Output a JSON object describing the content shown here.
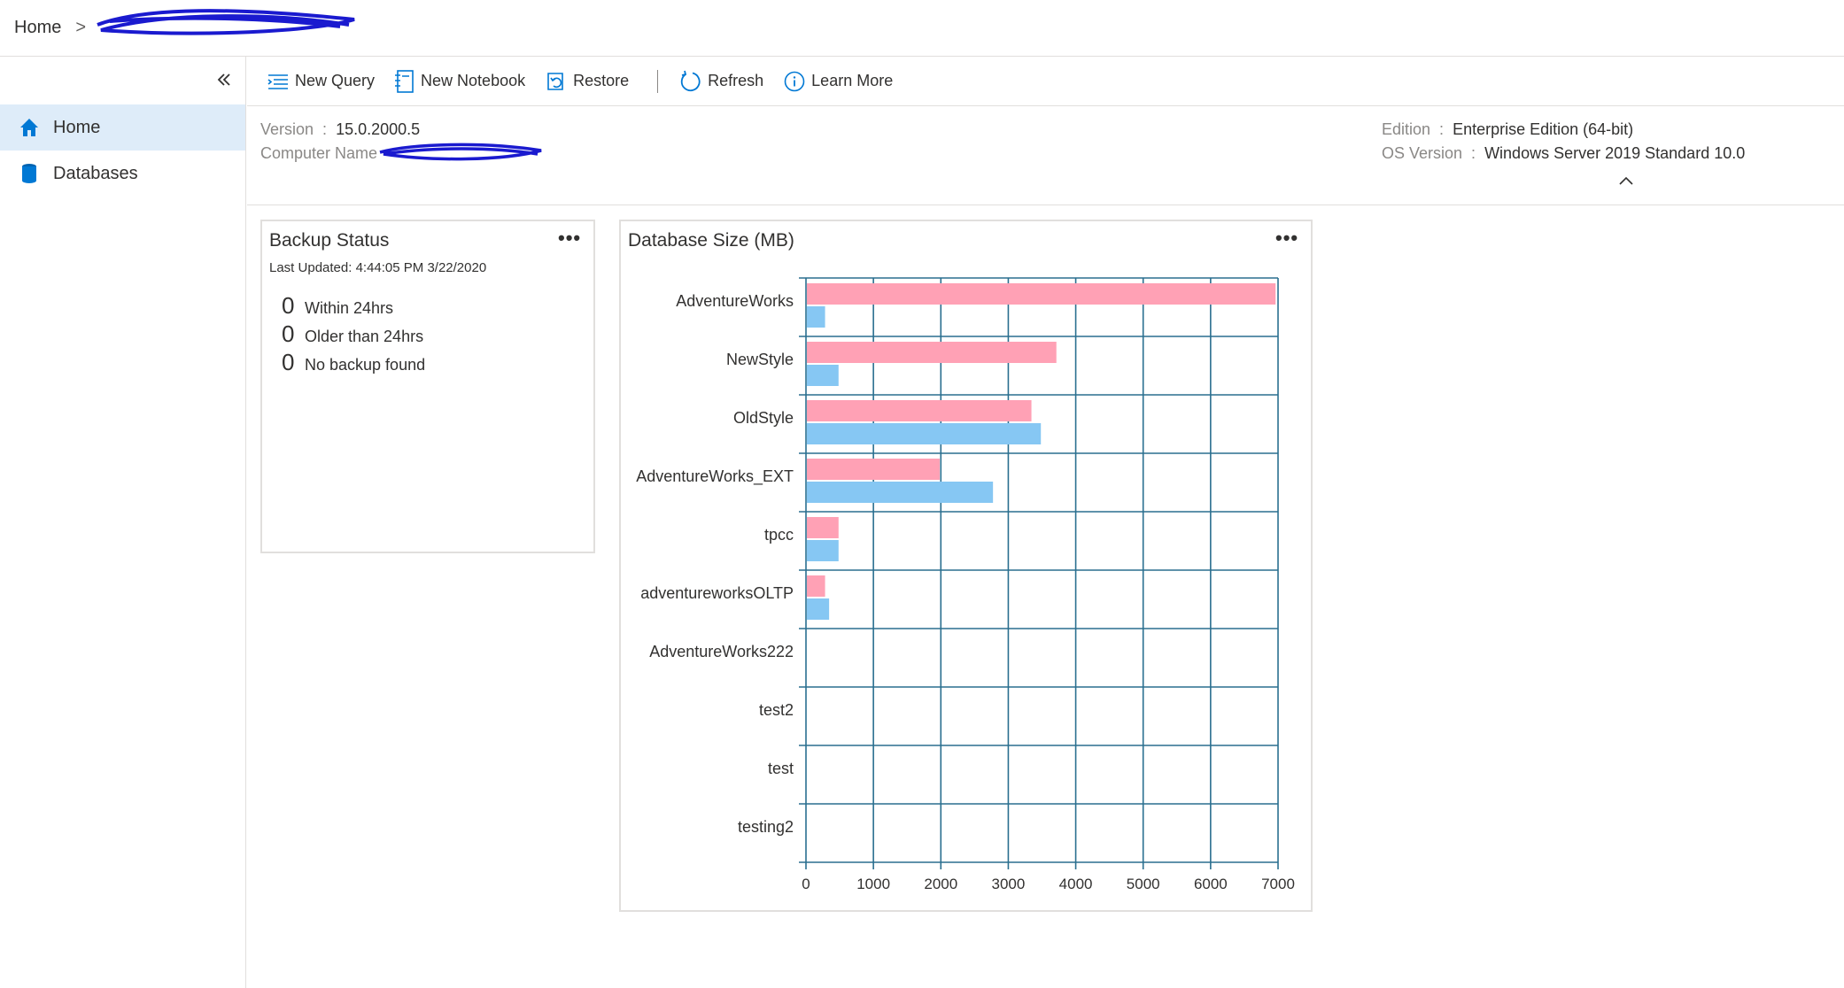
{
  "breadcrumb": {
    "home": "Home",
    "separator": ">"
  },
  "sidebar": {
    "items": [
      {
        "label": "Home",
        "icon": "home-icon",
        "active": true
      },
      {
        "label": "Databases",
        "icon": "database-icon",
        "active": false
      }
    ]
  },
  "toolbar": {
    "new_query": "New Query",
    "new_notebook": "New Notebook",
    "restore": "Restore",
    "refresh": "Refresh",
    "learn_more": "Learn More"
  },
  "properties": {
    "version_label": "Version",
    "version_value": "15.0.2000.5",
    "computer_name_label": "Computer Name",
    "edition_label": "Edition",
    "edition_value": "Enterprise Edition (64-bit)",
    "os_version_label": "OS Version",
    "os_version_value": "Windows Server 2019 Standard 10.0",
    "colon": ":"
  },
  "backup_status": {
    "title": "Backup Status",
    "last_updated": "Last Updated: 4:44:05 PM 3/22/2020",
    "rows": [
      {
        "count": "0",
        "label": "Within 24hrs"
      },
      {
        "count": "0",
        "label": "Older than 24hrs"
      },
      {
        "count": "0",
        "label": "No backup found"
      }
    ]
  },
  "more_label": "•••",
  "colors": {
    "accent": "#0078d4",
    "active_bg": "#deecf9",
    "series_1": "#ffa1b5",
    "series_2": "#86c7f3",
    "grid": "#2a6f8f"
  },
  "chart_data": {
    "type": "bar",
    "orientation": "horizontal",
    "title": "Database Size (MB)",
    "categories": [
      "AdventureWorks",
      "NewStyle",
      "OldStyle",
      "AdventureWorks_EXT",
      "tpcc",
      "adventureworksOLTP",
      "AdventureWorks222",
      "test2",
      "test",
      "testing2"
    ],
    "series": [
      {
        "color": "#ffa1b5",
        "values": [
          6950,
          3700,
          3330,
          1970,
          470,
          270,
          0,
          0,
          0,
          0
        ]
      },
      {
        "color": "#86c7f3",
        "values": [
          270,
          470,
          3470,
          2760,
          470,
          330,
          0,
          0,
          0,
          0
        ]
      }
    ],
    "xlim": [
      0,
      7000
    ],
    "xticks": [
      "0",
      "1000",
      "2000",
      "3000",
      "4000",
      "5000",
      "6000",
      "7000"
    ],
    "grid": true,
    "legend": "none"
  }
}
